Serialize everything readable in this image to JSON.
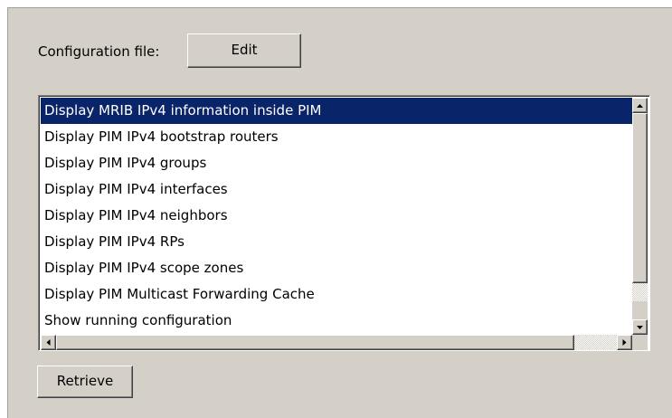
{
  "config": {
    "label": "Configuration file:",
    "edit_label": "Edit"
  },
  "commands": [
    {
      "label": "Display MRIB IPv4 information inside PIM",
      "selected": true
    },
    {
      "label": "Display PIM IPv4 bootstrap routers",
      "selected": false
    },
    {
      "label": "Display PIM IPv4 groups",
      "selected": false
    },
    {
      "label": "Display PIM IPv4 interfaces",
      "selected": false
    },
    {
      "label": "Display PIM IPv4 neighbors",
      "selected": false
    },
    {
      "label": "Display PIM IPv4 RPs",
      "selected": false
    },
    {
      "label": "Display PIM IPv4 scope zones",
      "selected": false
    },
    {
      "label": "Display PIM Multicast Forwarding Cache",
      "selected": false
    },
    {
      "label": "Show running configuration",
      "selected": false
    }
  ],
  "actions": {
    "retrieve_label": "Retrieve"
  },
  "colors": {
    "panel": "#d4d0c8",
    "selection": "#0a246a",
    "selection_text": "#ffffff"
  },
  "icons": {
    "scroll_up": "triangle-up-icon",
    "scroll_down": "triangle-down-icon",
    "scroll_left": "triangle-left-icon",
    "scroll_right": "triangle-right-icon"
  }
}
